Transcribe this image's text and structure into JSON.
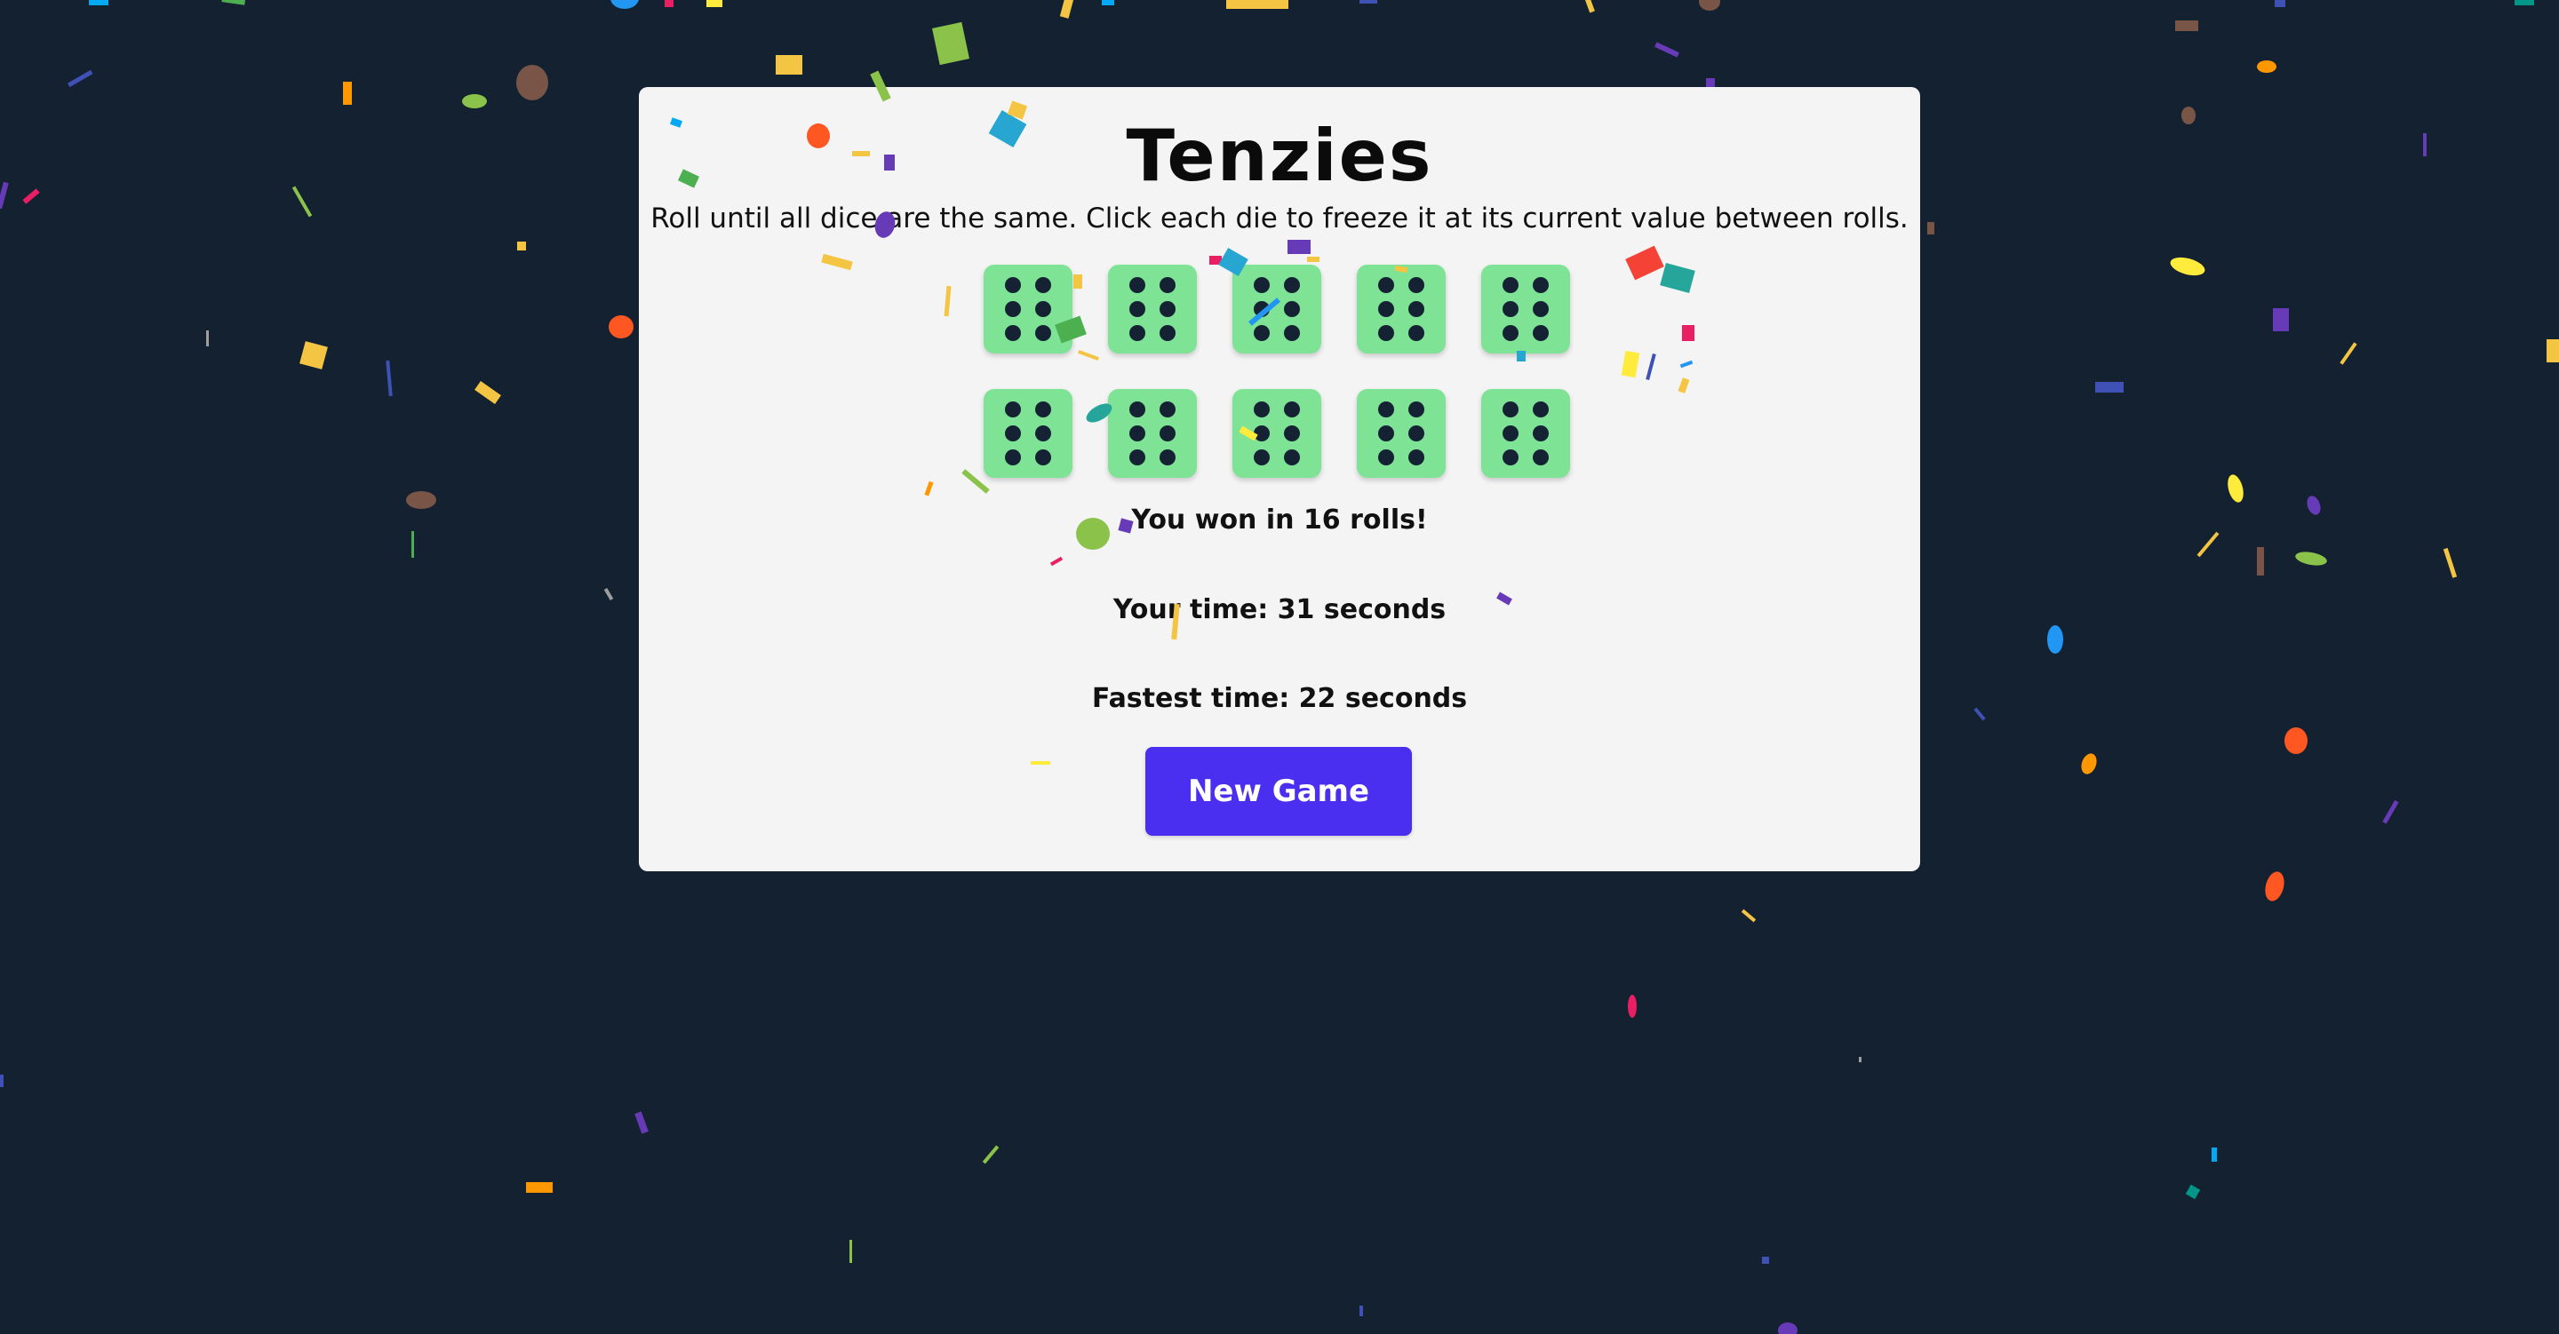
{
  "game": {
    "title": "Tenzies",
    "instructions": "Roll until all dice are the same. Click each die to freeze it at its current value between rolls.",
    "dice": [
      {
        "value": 6,
        "held": true
      },
      {
        "value": 6,
        "held": true
      },
      {
        "value": 6,
        "held": true
      },
      {
        "value": 6,
        "held": true
      },
      {
        "value": 6,
        "held": true
      },
      {
        "value": 6,
        "held": true
      },
      {
        "value": 6,
        "held": true
      },
      {
        "value": 6,
        "held": true
      },
      {
        "value": 6,
        "held": true
      },
      {
        "value": 6,
        "held": true
      }
    ],
    "won_text": "You won in 16 rolls!",
    "your_time_text": "Your time: 31 seconds",
    "fastest_time_text": "Fastest time: 22 seconds",
    "new_game_label": "New Game"
  },
  "colors": {
    "background": "#132131",
    "panel": "#f4f4f4",
    "held_die": "#7ee395",
    "pip": "#142233",
    "button": "#4a2ff0"
  }
}
